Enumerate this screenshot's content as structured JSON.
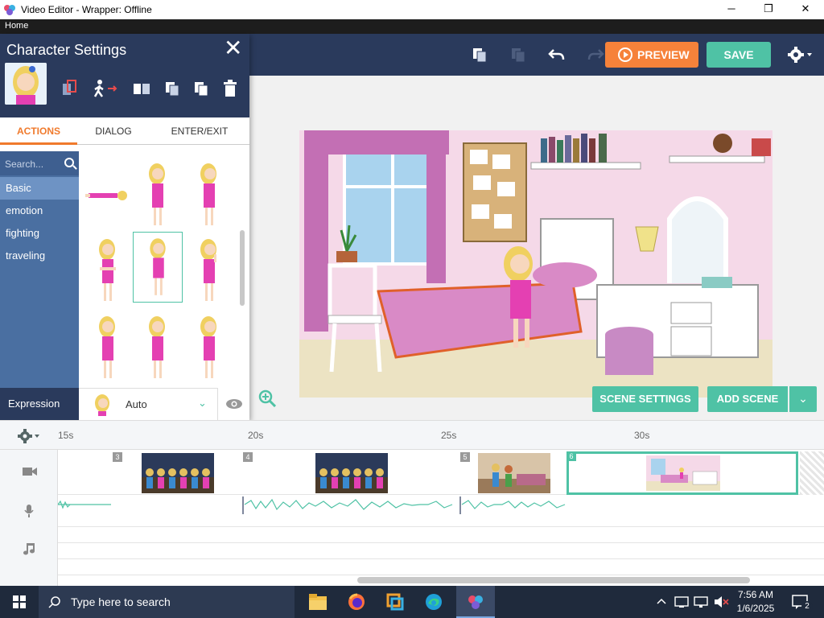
{
  "window": {
    "title": "Video Editor - Wrapper: Offline",
    "minimize": "─",
    "maximize": "❐",
    "close": "✕"
  },
  "menu": {
    "home": "Home"
  },
  "toolbar": {
    "preview_label": "PREVIEW",
    "save_label": "SAVE",
    "accent_orange": "#f6823a",
    "accent_teal": "#4fc2a5"
  },
  "char_panel": {
    "title": "Character Settings",
    "close": "✕",
    "tabs": [
      {
        "label": "ACTIONS",
        "active": true
      },
      {
        "label": "DIALOG",
        "active": false
      },
      {
        "label": "ENTER/EXIT",
        "active": false
      }
    ],
    "search_placeholder": "Search...",
    "categories": [
      {
        "label": "Basic",
        "active": true
      },
      {
        "label": "emotion",
        "active": false
      },
      {
        "label": "fighting",
        "active": false
      },
      {
        "label": "traveling",
        "active": false
      }
    ],
    "expression_label": "Expression",
    "expression_value": "Auto"
  },
  "stage": {
    "scene_settings_label": "SCENE SETTINGS",
    "add_scene_label": "ADD SCENE"
  },
  "timeline": {
    "ticks": [
      "15s",
      "20s",
      "25s",
      "30s"
    ],
    "scenes": [
      "3",
      "4",
      "5",
      "6"
    ]
  },
  "taskbar": {
    "search_placeholder": "Type here to search",
    "time": "7:56 AM",
    "date": "1/6/2025",
    "notification_count": "2"
  }
}
